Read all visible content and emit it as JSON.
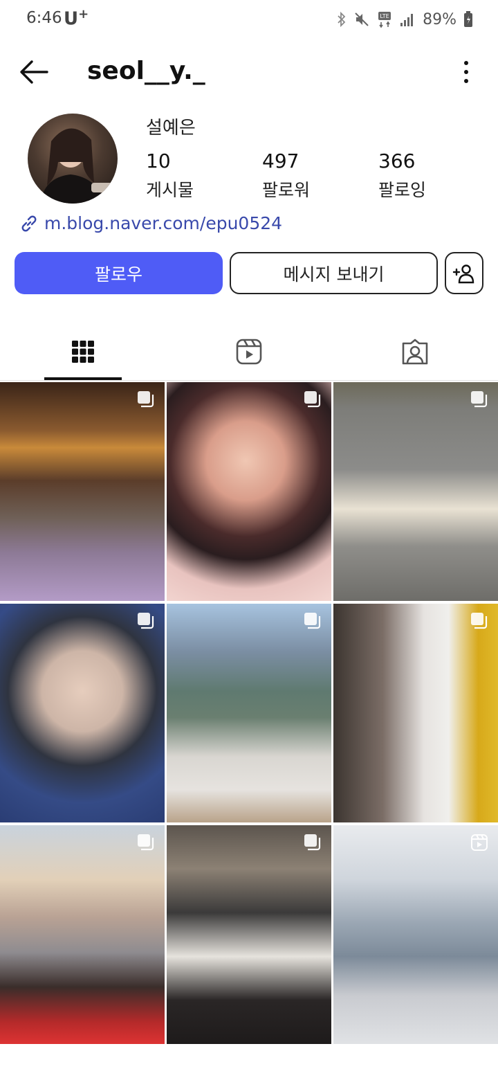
{
  "status_bar": {
    "time": "6:46",
    "carrier": "U",
    "carrier_sup": "+",
    "battery_percent": "89%",
    "icons": [
      "bluetooth-icon",
      "mute-icon",
      "lte-icon",
      "signal-icon",
      "battery-icon"
    ]
  },
  "header": {
    "username": "seol__y._",
    "back_icon": "arrow-left-icon",
    "more_icon": "more-vertical-icon"
  },
  "profile": {
    "display_name": "설예은",
    "stats": [
      {
        "value": "10",
        "label": "게시물"
      },
      {
        "value": "497",
        "label": "팔로워"
      },
      {
        "value": "366",
        "label": "팔로잉"
      }
    ],
    "link": "m.blog.naver.com/epu0524"
  },
  "actions": {
    "follow_label": "팔로우",
    "message_label": "메시지 보내기",
    "add_user_icon": "add-user-icon"
  },
  "colors": {
    "accent": "#4f5cf6",
    "link": "#3949ab"
  },
  "tabs": [
    {
      "icon": "grid-icon",
      "active": true
    },
    {
      "icon": "reels-icon",
      "active": false
    },
    {
      "icon": "tagged-icon",
      "active": false
    }
  ],
  "posts": [
    {
      "badge": "carousel-icon"
    },
    {
      "badge": "carousel-icon"
    },
    {
      "badge": "carousel-icon"
    },
    {
      "badge": "carousel-icon"
    },
    {
      "badge": "carousel-icon"
    },
    {
      "badge": "carousel-icon"
    },
    {
      "badge": "carousel-icon"
    },
    {
      "badge": "carousel-icon"
    },
    {
      "badge": "reels-icon"
    }
  ]
}
